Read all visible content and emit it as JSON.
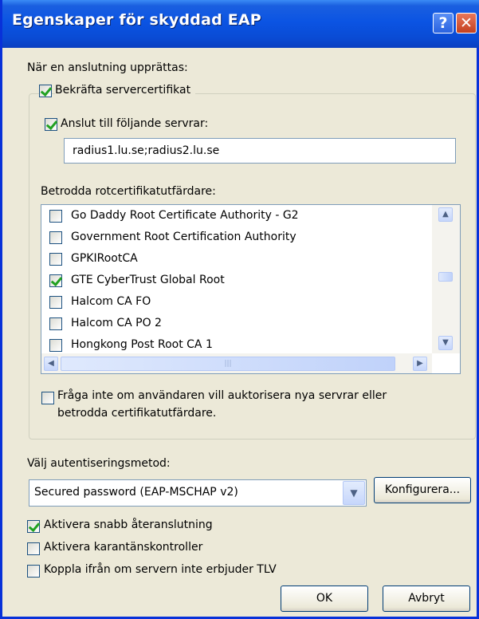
{
  "window": {
    "title": "Egenskaper för skyddad EAP",
    "help_glyph": "?",
    "close_glyph": "✕"
  },
  "connect_heading": "När en anslutning upprättas:",
  "validate_cert": {
    "label": "Bekräfta servercertifikat",
    "checked": true
  },
  "connect_servers": {
    "label": "Anslut till följande servrar:",
    "checked": true,
    "value": "radius1.lu.se;radius2.lu.se"
  },
  "trusted_ca_heading": "Betrodda rotcertifikatutfärdare:",
  "ca_list": [
    {
      "name": "Go Daddy Root Certificate Authority - G2",
      "checked": false
    },
    {
      "name": "Government Root Certification Authority",
      "checked": false
    },
    {
      "name": "GPKIRootCA",
      "checked": false
    },
    {
      "name": "GTE CyberTrust Global Root",
      "checked": true
    },
    {
      "name": "Halcom CA FO",
      "checked": false
    },
    {
      "name": "Halcom CA PO 2",
      "checked": false
    },
    {
      "name": "Hongkong Post Root CA 1",
      "checked": false
    }
  ],
  "scrollbar_glyphs": {
    "up": "▲",
    "down": "▼",
    "left": "◀",
    "right": "▶",
    "grip": "|||"
  },
  "no_prompt": {
    "line1": "Fråga inte om användaren vill auktorisera nya servrar eller",
    "line2": "betrodda certifikatutfärdare.",
    "checked": false
  },
  "auth_method_heading": "Välj autentiseringsmetod:",
  "auth_method": {
    "selected": "Secured password (EAP-MSCHAP v2)",
    "arrow": "▼"
  },
  "configure_button": "Konfigurera...",
  "fast_reconnect": {
    "label": "Aktivera snabb återanslutning",
    "checked": true
  },
  "quarantine": {
    "label": "Aktivera karantänskontroller",
    "checked": false
  },
  "disconnect_tlv": {
    "label": "Koppla ifrån om servern inte erbjuder TLV",
    "checked": false
  },
  "ok_button": "OK",
  "cancel_button": "Avbryt"
}
